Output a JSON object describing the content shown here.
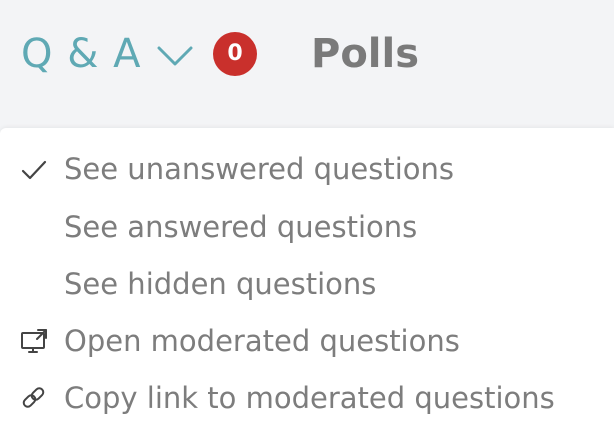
{
  "header": {
    "qa_tab_label": "Q & A",
    "qa_badge_count": "0",
    "polls_tab_label": "Polls"
  },
  "menu": {
    "items": [
      {
        "label": "See unanswered questions",
        "icon": "checkmark-icon",
        "selected": true
      },
      {
        "label": "See answered questions",
        "icon": null,
        "selected": false
      },
      {
        "label": "See hidden questions",
        "icon": null,
        "selected": false
      },
      {
        "label": "Open moderated questions",
        "icon": "open-in-window-icon",
        "selected": false
      },
      {
        "label": "Copy link to moderated questions",
        "icon": "link-icon",
        "selected": false
      }
    ]
  },
  "colors": {
    "accent": "#5fa9b4",
    "badge": "#c9302c",
    "text": "#7d7d7d",
    "icon": "#444444"
  }
}
